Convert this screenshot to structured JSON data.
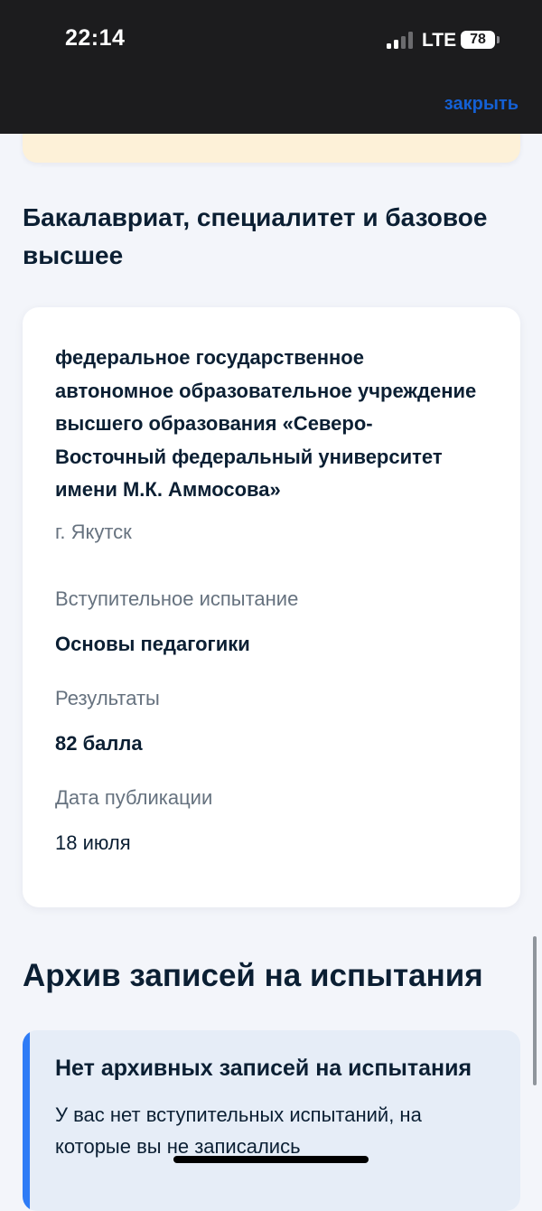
{
  "status_bar": {
    "time": "22:14",
    "network": "LTE",
    "battery": "78"
  },
  "header": {
    "close_label": "закрыть"
  },
  "section": {
    "title": "Бакалавриат, специалитет и базовое высшее"
  },
  "card": {
    "university": "федеральное государственное автономное образовательное учреждение высшего образования «Северо-Восточный федеральный университет имени М.К. Аммосова»",
    "city": "г. Якутск",
    "exam_label": "Вступительное испытание",
    "exam_value": "Основы педагогики",
    "results_label": "Результаты",
    "results_value": "82 балла",
    "date_label": "Дата публикации",
    "date_value": "18 июля"
  },
  "archive": {
    "title": "Архив записей на испытания",
    "info_title": "Нет архивных записей на испытания",
    "info_text": "У вас нет вступительных испытаний, на которые вы не записались"
  },
  "colors": {
    "accent": "#1460d4",
    "info_bar": "#2f7cf6",
    "notice_bg": "#fdf1d8"
  }
}
